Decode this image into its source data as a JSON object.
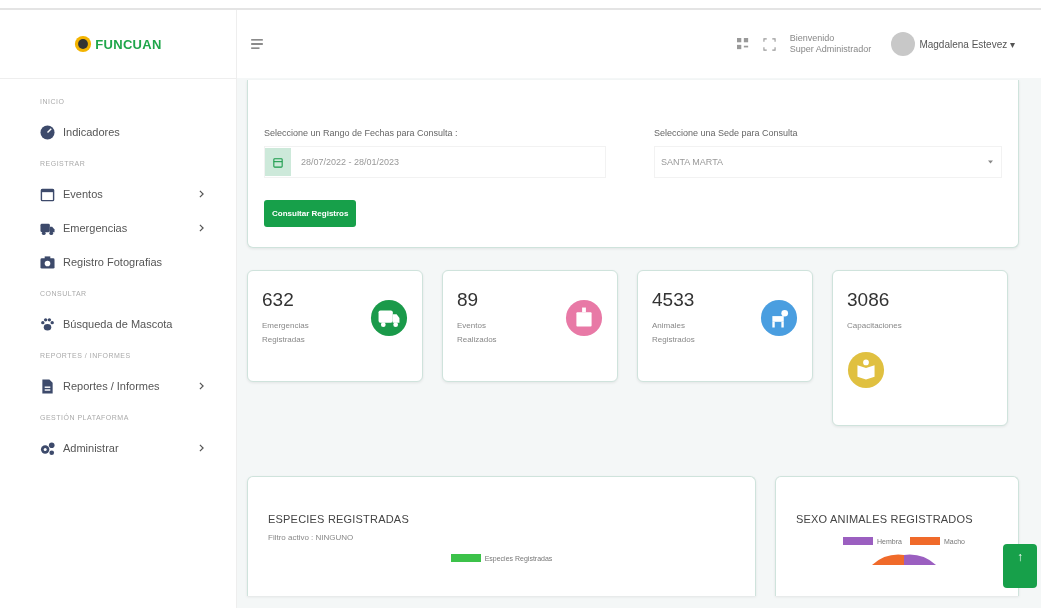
{
  "logo": {
    "name": "FUNCUAN"
  },
  "topbar": {
    "welcome": "Bienvenido",
    "role": "Super Administrador",
    "user": "Magdalena Estevez ▾"
  },
  "sidebar": {
    "items": [
      {
        "kind": "header",
        "label": "INICIO"
      },
      {
        "kind": "link",
        "label": "Indicadores",
        "submenu": false
      },
      {
        "kind": "header",
        "label": "REGISTRAR"
      },
      {
        "kind": "link",
        "label": "Eventos",
        "submenu": true
      },
      {
        "kind": "link",
        "label": "Emergencias",
        "submenu": true
      },
      {
        "kind": "link",
        "label": "Registro Fotografias",
        "submenu": false
      },
      {
        "kind": "header",
        "label": "CONSULTAR"
      },
      {
        "kind": "link",
        "label": "Búsqueda de Mascota",
        "submenu": false
      },
      {
        "kind": "header",
        "label": "REPORTES / INFORMES"
      },
      {
        "kind": "link",
        "label": "Reportes / Informes",
        "submenu": true
      },
      {
        "kind": "header",
        "label": "GESTIÓN PLATAFORMA"
      },
      {
        "kind": "link",
        "label": "Administrar",
        "submenu": true
      }
    ]
  },
  "filters": {
    "date_label": "Seleccione un Rango de Fechas para Consulta :",
    "date_value": "28/07/2022 - 28/01/2023",
    "site_label": "Seleccione una Sede para Consulta",
    "site_value": "SANTA MARTA",
    "button": "Consultar Registros"
  },
  "stats": [
    {
      "value": "632",
      "label": "Emergencias Registradas",
      "color": "#1a9a4a"
    },
    {
      "value": "89",
      "label": "Eventos Realizados",
      "color": "#e879a6"
    },
    {
      "value": "4533",
      "label": "Animales Registrados",
      "color": "#4a9ee0"
    },
    {
      "value": "3086",
      "label": "Capacitaciones",
      "color": "#e0c040"
    }
  ],
  "species_panel": {
    "title": "ESPECIES REGISTRADAS",
    "filter": "Filtro activo : NINGUNO",
    "legend": [
      {
        "label": "Especies Registradas",
        "color": "#3cc24a"
      }
    ]
  },
  "sex_panel": {
    "title": "SEXO ANIMALES REGISTRADOS",
    "legend": [
      {
        "label": "Hembra",
        "color": "#9b5fc0"
      },
      {
        "label": "Macho",
        "color": "#f06a2a"
      }
    ]
  },
  "scroll_top": {
    "label": "↑"
  }
}
